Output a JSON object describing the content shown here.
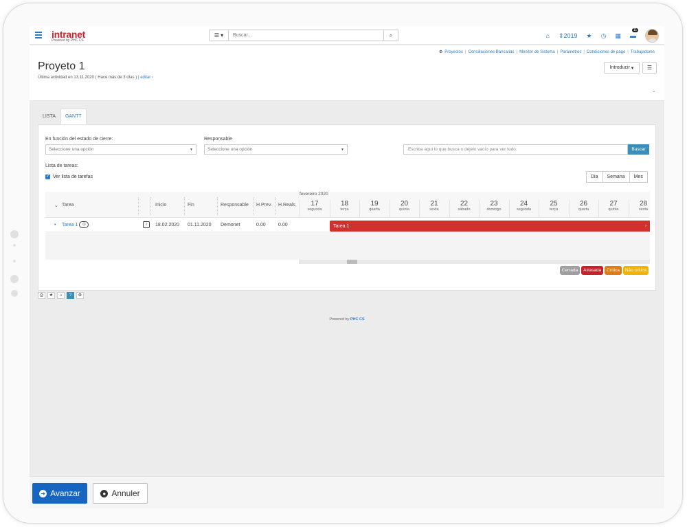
{
  "app": {
    "logo": "intranet",
    "logo_sub": "Powered by PHC CS"
  },
  "topnav": {
    "search_placeholder": "Buscar...",
    "year": "2019",
    "notif_count": "11"
  },
  "breadcrumb": [
    "Proyectos",
    "Conciliaciones Bancarias",
    "Monitor de Sistema",
    "Parámetros",
    "Condiciones de pago",
    "Trabajadores"
  ],
  "header": {
    "title": "Proyeto 1",
    "activity_text": "Última actividad en 13.11.2020 ( Hace más de 3 días )",
    "edit_link": "editar",
    "introducir_label": "Introducir"
  },
  "tabs": [
    "LISTA",
    "GANTT"
  ],
  "filters": {
    "estado_label": "En función del estado de cierre:",
    "estado_placeholder": "Seleccione una opción",
    "responsable_label": "Responsable",
    "responsable_placeholder": "Seleccione una opción",
    "search_placeholder": "Escriba aquí lo que busca o déjelo vacío para ver todo.",
    "search_button": "Buscar",
    "lista_label": "Lista de tareas:",
    "ver_lista": "Ver lista de tarefas"
  },
  "view_buttons": [
    "Dia",
    "Semana",
    "Mes"
  ],
  "gantt": {
    "columns": [
      "Tarea",
      "Inicio",
      "Fin",
      "Responsable",
      "H.Prev.",
      "H.Reals"
    ],
    "month": "fevereiro 2020",
    "days": [
      {
        "num": "17",
        "wd": "segunda"
      },
      {
        "num": "18",
        "wd": "terça"
      },
      {
        "num": "19",
        "wd": "quarta"
      },
      {
        "num": "20",
        "wd": "quinta"
      },
      {
        "num": "21",
        "wd": "sexta"
      },
      {
        "num": "22",
        "wd": "sábado"
      },
      {
        "num": "23",
        "wd": "domingo"
      },
      {
        "num": "24",
        "wd": "segunda"
      },
      {
        "num": "25",
        "wd": "terça"
      },
      {
        "num": "26",
        "wd": "quarta"
      },
      {
        "num": "27",
        "wd": "quinta"
      },
      {
        "num": "28",
        "wd": "sexta"
      }
    ],
    "row": {
      "name": "Tarea 1",
      "inicio": "18.02.2020",
      "fin": "01.11.2020",
      "responsable": "Demonet",
      "hprev": "0.00",
      "hreals": "0.00",
      "bar_label": "Tarea 1",
      "bar_color": "#d22f2f"
    }
  },
  "legend": [
    {
      "label": "Cerrada",
      "color": "#9e9e9e"
    },
    {
      "label": "Atrasada",
      "color": "#c9202a"
    },
    {
      "label": "Crítica",
      "color": "#e07b12"
    },
    {
      "label": "Não crítica",
      "color": "#f0b400"
    }
  ],
  "powered": {
    "prefix": "Powered by",
    "brand": "PHC CS"
  },
  "footer": {
    "avanzar": "Avanzar",
    "annuler": "Annuler"
  }
}
